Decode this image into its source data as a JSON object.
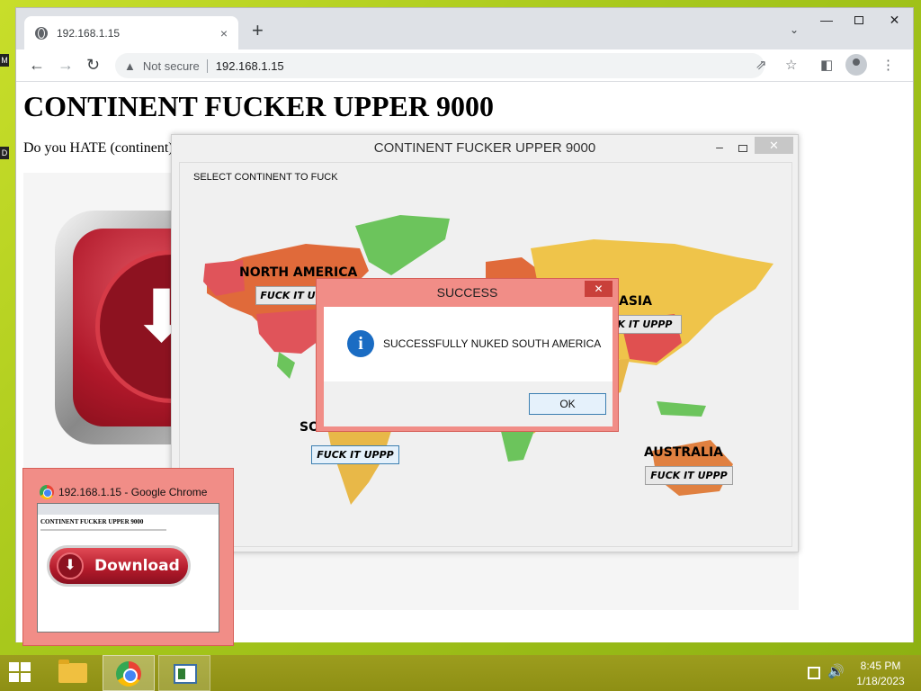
{
  "browser": {
    "tab_title": "192.168.1.15",
    "tab_close": "×",
    "new_tab": "+",
    "tab_search": "⌄",
    "win_min": "—",
    "win_close": "✕",
    "back": "←",
    "forward": "→",
    "reload": "↻",
    "security_icon": "▲",
    "security_text": "Not secure",
    "url": "192.168.1.15",
    "share": "⇗",
    "bookmark": "☆",
    "sidepanel": "◧",
    "menu": "⋮"
  },
  "page": {
    "heading": "CONTINENT FUCKER UPPER 9000",
    "intro": "Do you HATE (continent)",
    "download_arrow": "⬇"
  },
  "app": {
    "title": "CONTINENT FUCKER UPPER 9000",
    "min": "–",
    "close": "✕",
    "select_label": "SELECT CONTINENT TO FUCK",
    "continents": {
      "north_america": {
        "label": "NORTH AMERICA",
        "button": "FUCK IT U"
      },
      "asia": {
        "label": "ASIA",
        "button": "K IT UPPP"
      },
      "south_america": {
        "label": "SO",
        "button": "FUCK IT UPPP"
      },
      "australia": {
        "label": "AUSTRALIA",
        "button": "FUCK IT UPPP"
      }
    },
    "map_colors": {
      "north_america": "#e06a3a",
      "greenland": "#6cc45c",
      "europe_asia": "#efc44a",
      "usa": "#e0545a",
      "africa": "#e8b848",
      "australia": "#e08040",
      "china": "#e05050",
      "ocean": "#f0f0f0"
    }
  },
  "dialog": {
    "title": "SUCCESS",
    "close": "✕",
    "info_icon": "i",
    "message": "SUCCESSFULLY NUKED SOUTH AMERICA",
    "ok_label": "OK"
  },
  "thumbnail": {
    "title": "192.168.1.15 - Google Chrome",
    "preview_heading": "CONTINENT FUCKER UPPER 9000",
    "download_label": "Download",
    "download_icon": "⬇"
  },
  "taskbar": {
    "volume_icon": "🔊",
    "time": "8:45 PM",
    "date": "1/18/2023"
  },
  "desktop": {
    "icon_a": "M",
    "icon_b": "D"
  }
}
